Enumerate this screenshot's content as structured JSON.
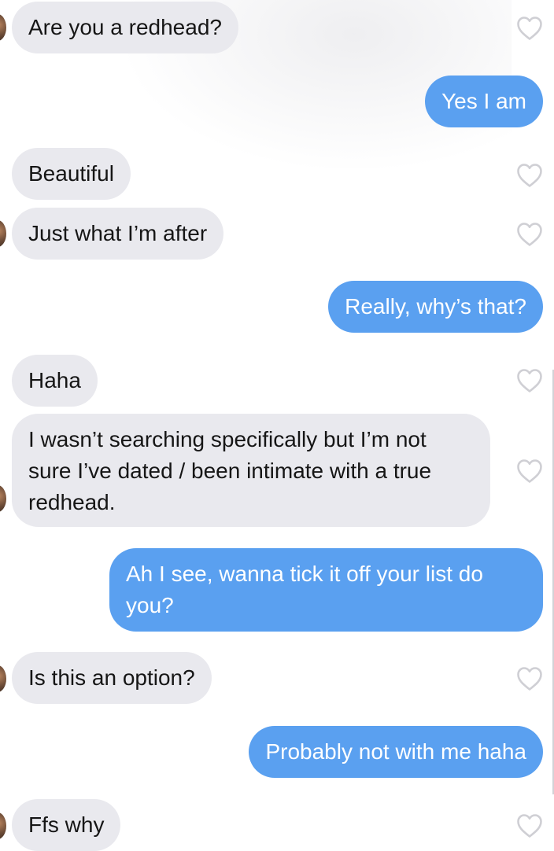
{
  "conversation": {
    "messages": [
      {
        "direction": "received",
        "text": "Are you a redhead?"
      },
      {
        "direction": "sent",
        "text": "Yes I am"
      },
      {
        "direction": "received",
        "text": "Beautiful"
      },
      {
        "direction": "received",
        "text": "Just what I’m after"
      },
      {
        "direction": "sent",
        "text": "Really, why’s that?"
      },
      {
        "direction": "received",
        "text": "Haha"
      },
      {
        "direction": "received",
        "text": "I wasn’t searching specifically but I’m not sure I’ve dated / been intimate with a true redhead."
      },
      {
        "direction": "sent",
        "text": "Ah I see, wanna tick it off your list do you?"
      },
      {
        "direction": "received",
        "text": "Is this an option?"
      },
      {
        "direction": "sent",
        "text": "Probably not with me haha"
      },
      {
        "direction": "received",
        "text": "Ffs why"
      }
    ]
  },
  "icons": {
    "like": "heart-outline-icon",
    "avatar": "avatar"
  },
  "colors": {
    "sent_bubble": "#5aa0f0",
    "received_bubble": "#e9e9ee",
    "heart_stroke": "#cfcfd4"
  }
}
